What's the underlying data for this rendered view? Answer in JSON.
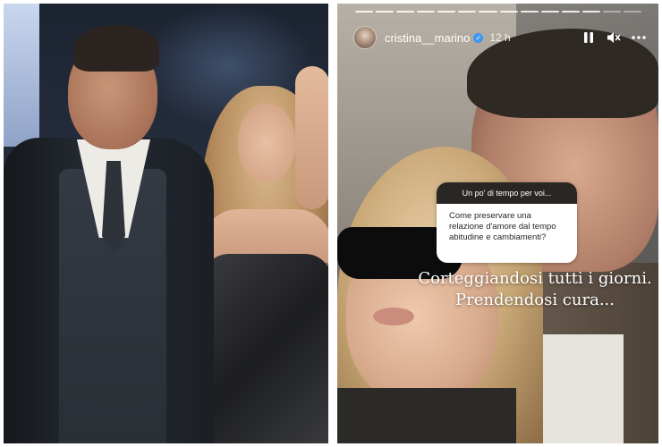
{
  "story": {
    "username": "cristina__marino",
    "time": "12 h",
    "progress_segments": 14,
    "progress_active": 12,
    "controls": [
      "pause-icon",
      "mute-icon",
      "more-icon"
    ],
    "question_sticker": {
      "header": "Un po' di tempo per voi...",
      "question": "Come preservare una relazione d'amore dal tempo abitudine e cambiamenti?"
    },
    "answer_lines": [
      "Corteggiandosi tutti i giorni.",
      "Prendendosi cura..."
    ]
  }
}
